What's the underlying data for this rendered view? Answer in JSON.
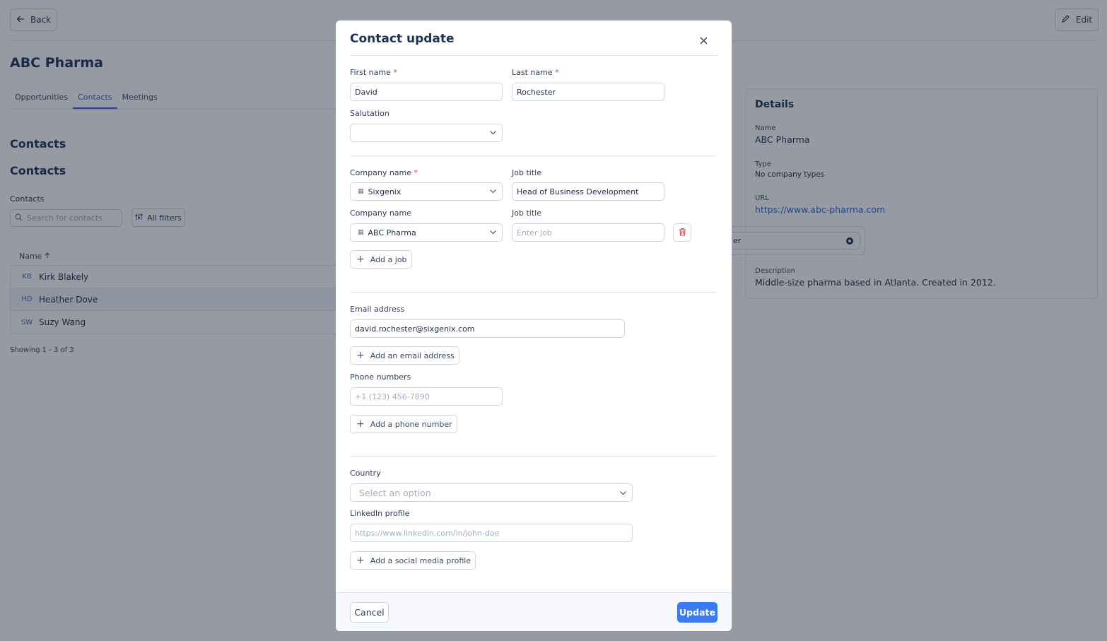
{
  "page": {
    "back_label": "Back",
    "edit_label": "Edit",
    "company_name": "ABC Pharma",
    "tabs": [
      {
        "label": "Opportunities",
        "active": false
      },
      {
        "label": "Contacts",
        "active": true
      },
      {
        "label": "Meetings",
        "active": false
      }
    ],
    "section_title_1": "Contacts",
    "section_title_2": "Contacts",
    "contacts_label": "Contacts",
    "search_placeholder": "Search for contacts",
    "filters_label": "All filters",
    "column_name": "Name",
    "rows": [
      {
        "initials": "KB",
        "name": "Kirk Blakely"
      },
      {
        "initials": "HD",
        "name": "Heather Dove"
      },
      {
        "initials": "SW",
        "name": "Suzy Wang"
      }
    ],
    "showing": "Showing 1 - 3 of 3",
    "details": {
      "title": "Details",
      "name_label": "Name",
      "name_value": "ABC Pharma",
      "type_label": "Type",
      "type_value": "No company types",
      "url_label": "URL",
      "url_value": "https://www.abc-pharma.com",
      "description_label": "Description",
      "description_value": "Middle-size pharma based in Atlanta. Created in 2012."
    },
    "ghost_input_text": "er"
  },
  "modal": {
    "title": "Contact update",
    "first_name_label": "First name",
    "first_name_value": "David",
    "last_name_label": "Last name",
    "last_name_value": "Rochester",
    "salutation_label": "Salutation",
    "salutation_value": "",
    "jobs": [
      {
        "company_label": "Company name",
        "company_value": "Sixgenix",
        "job_label": "Job title",
        "job_value": "Head of Business Development",
        "job_placeholder": "Enter job",
        "required": true
      },
      {
        "company_label": "Company name",
        "company_value": "ABC Pharma",
        "job_label": "Job title",
        "job_value": "",
        "job_placeholder": "Enter job",
        "required": false
      }
    ],
    "add_job_label": "Add a job",
    "email_label": "Email address",
    "email_value": "david.rochester@sixgenix.com",
    "add_email_label": "Add an email address",
    "phone_label": "Phone numbers",
    "phone_placeholder": "+1 (123) 456-7890",
    "add_phone_label": "Add a phone number",
    "country_label": "Country",
    "country_placeholder": "Select an option",
    "linkedin_label": "LinkedIn profile",
    "linkedin_placeholder": "https://www.linkedin.com/in/john-doe",
    "add_social_label": "Add a social media profile",
    "cancel_label": "Cancel",
    "update_label": "Update",
    "required_mark": "*"
  },
  "colors": {
    "accent": "#3a7cf0",
    "link": "#2f64d6",
    "required": "#d6453d",
    "overlay": "rgba(20,30,50,0.45)"
  }
}
